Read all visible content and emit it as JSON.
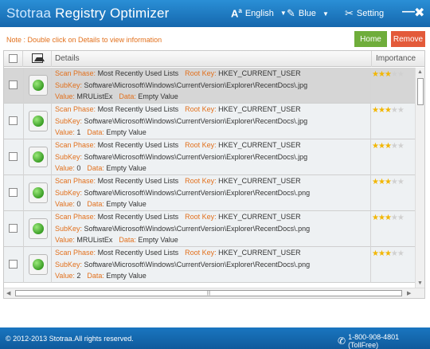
{
  "app": {
    "title_brand": "Stotraa",
    "title_rest": " Registry Optimizer",
    "language": "English",
    "skin": "Blue",
    "setting": "Setting",
    "minimize_glyph": "—",
    "close_glyph": "✖"
  },
  "note": "Note : Double click on Details to view information",
  "buttons": {
    "home": "Home",
    "remove": "Remove"
  },
  "table": {
    "col_details": "Details",
    "col_importance": "Importance",
    "labels": {
      "scan_phase": "Scan Phase:",
      "root_key": "Root Key:",
      "subkey": "SubKey:",
      "value": "Value:",
      "data": "Data:"
    },
    "rows": [
      {
        "scan_phase": "Most Recently Used Lists",
        "root_key": "HKEY_CURRENT_USER",
        "subkey": "Software\\Microsoft\\Windows\\CurrentVersion\\Explorer\\RecentDocs\\.jpg",
        "value": "MRUListEx",
        "data": "Empty Value",
        "stars": 3,
        "selected": true
      },
      {
        "scan_phase": "Most Recently Used Lists",
        "root_key": "HKEY_CURRENT_USER",
        "subkey": "Software\\Microsoft\\Windows\\CurrentVersion\\Explorer\\RecentDocs\\.jpg",
        "value": "1",
        "data": "Empty Value",
        "stars": 3,
        "selected": false
      },
      {
        "scan_phase": "Most Recently Used Lists",
        "root_key": "HKEY_CURRENT_USER",
        "subkey": "Software\\Microsoft\\Windows\\CurrentVersion\\Explorer\\RecentDocs\\.jpg",
        "value": "0",
        "data": "Empty Value",
        "stars": 3,
        "selected": false
      },
      {
        "scan_phase": "Most Recently Used Lists",
        "root_key": "HKEY_CURRENT_USER",
        "subkey": "Software\\Microsoft\\Windows\\CurrentVersion\\Explorer\\RecentDocs\\.png",
        "value": "0",
        "data": "Empty Value",
        "stars": 3,
        "selected": false
      },
      {
        "scan_phase": "Most Recently Used Lists",
        "root_key": "HKEY_CURRENT_USER",
        "subkey": "Software\\Microsoft\\Windows\\CurrentVersion\\Explorer\\RecentDocs\\.png",
        "value": "MRUListEx",
        "data": "Empty Value",
        "stars": 3,
        "selected": false
      },
      {
        "scan_phase": "Most Recently Used Lists",
        "root_key": "HKEY_CURRENT_USER",
        "subkey": "Software\\Microsoft\\Windows\\CurrentVersion\\Explorer\\RecentDocs\\.png",
        "value": "2",
        "data": "Empty Value",
        "stars": 3,
        "selected": false
      }
    ]
  },
  "footer": {
    "copyright": "© 2012-2013 Stotraa.All rights reserved.",
    "phone": "1-800-908-4801 (TollFree)"
  },
  "colors": {
    "titlebar": "#1b76c0",
    "orange": "#e2701c",
    "home": "#6fad3b",
    "remove": "#e35a3a",
    "star": "#f2b600"
  }
}
